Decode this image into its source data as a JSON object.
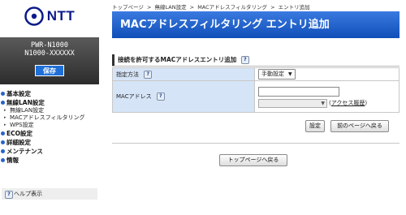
{
  "logo": {
    "text": "NTT"
  },
  "device": {
    "model_name": "PWR-N1000",
    "model_id": "N1000-XXXXXX",
    "save_label": "保存"
  },
  "nav": {
    "basic": "基本設定",
    "wlan": "無線LAN設定",
    "wlan_sub": [
      "無線LAN設定",
      "MACアドレスフィルタリング",
      "WPS設定"
    ],
    "eco": "ECO設定",
    "detail": "詳細設定",
    "maintenance": "メンテナンス",
    "info": "情報",
    "help": "ヘルプ表示"
  },
  "breadcrumb": [
    "トップページ",
    "無線LAN設定",
    "MACアドレスフィルタリング",
    "エントリ追加"
  ],
  "breadcrumb_sep": ">",
  "page": {
    "title": "MACアドレスフィルタリング エントリ追加"
  },
  "section": {
    "title": "接続を許可するMACアドレスエントリ追加"
  },
  "form": {
    "method_label": "指定方法",
    "method_value": "手動設定",
    "mac_label": "MACアドレス",
    "mac_value": "",
    "history_prefix": "(",
    "history_link": "アクセス履歴",
    "history_suffix": ")"
  },
  "buttons": {
    "set": "設定",
    "back": "前のページへ戻る",
    "top": "トップページへ戻る"
  },
  "help_icon_glyph": "?",
  "colors": {
    "title_bar": "#1f5fcc",
    "label_cell": "#d6e4f7",
    "save_button": "#1f6fd8",
    "nav_bullet": "#2a63c8"
  }
}
